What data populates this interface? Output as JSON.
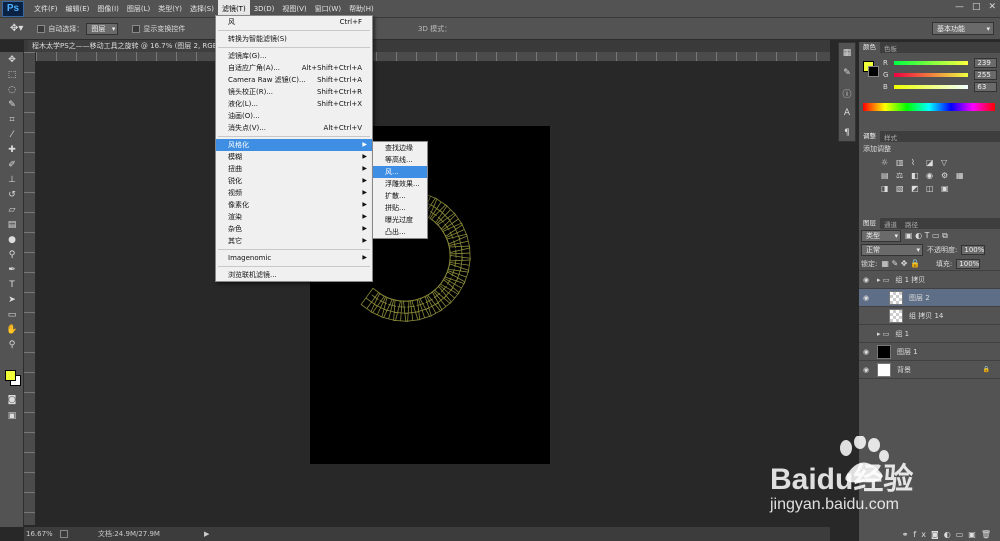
{
  "app": {
    "logo": "Ps"
  },
  "menubar": {
    "items": [
      "文件(F)",
      "编辑(E)",
      "图像(I)",
      "图层(L)",
      "类型(Y)",
      "选择(S)",
      "滤镜(T)",
      "3D(D)",
      "视图(V)",
      "窗口(W)",
      "帮助(H)"
    ],
    "active_index": 6,
    "window_controls": [
      "—",
      "□",
      "✕"
    ]
  },
  "options": {
    "auto_select_label": "自动选择：",
    "auto_select_value": "图层",
    "show_transform_label": "显示变换控件",
    "three_d_label": "3D 模式：",
    "workspace": "基本功能"
  },
  "document": {
    "tab_title": "程木太学PS之——移动工具之旋转 @ 16.7% (图层 2, RGB/8)"
  },
  "status": {
    "zoom": "16.67%",
    "doc_info": "文档:24.9M/27.9M"
  },
  "filter_menu": {
    "items": [
      {
        "label": "风",
        "shortcut": "Ctrl+F"
      },
      {
        "sep": true
      },
      {
        "label": "转换为智能滤镜(S)"
      },
      {
        "sep": true
      },
      {
        "label": "滤镜库(G)..."
      },
      {
        "label": "自适应广角(A)...",
        "shortcut": "Alt+Shift+Ctrl+A"
      },
      {
        "label": "Camera Raw 滤镜(C)...",
        "shortcut": "Shift+Ctrl+A"
      },
      {
        "label": "镜头校正(R)...",
        "shortcut": "Shift+Ctrl+R"
      },
      {
        "label": "液化(L)...",
        "shortcut": "Shift+Ctrl+X"
      },
      {
        "label": "油画(O)..."
      },
      {
        "label": "消失点(V)...",
        "shortcut": "Alt+Ctrl+V"
      },
      {
        "sep": true
      },
      {
        "label": "风格化",
        "sub": true,
        "highlight": true
      },
      {
        "label": "模糊",
        "sub": true
      },
      {
        "label": "扭曲",
        "sub": true
      },
      {
        "label": "锐化",
        "sub": true
      },
      {
        "label": "视频",
        "sub": true
      },
      {
        "label": "像素化",
        "sub": true
      },
      {
        "label": "渲染",
        "sub": true
      },
      {
        "label": "杂色",
        "sub": true
      },
      {
        "label": "其它",
        "sub": true
      },
      {
        "sep": true
      },
      {
        "label": "Imagenomic",
        "sub": true
      },
      {
        "sep": true
      },
      {
        "label": "浏览联机滤镜..."
      }
    ]
  },
  "stylize_submenu": {
    "items": [
      {
        "label": "查找边缘"
      },
      {
        "label": "等高线..."
      },
      {
        "label": "风...",
        "highlight": true
      },
      {
        "label": "浮雕效果..."
      },
      {
        "label": "扩散..."
      },
      {
        "label": "拼贴..."
      },
      {
        "label": "曝光过度"
      },
      {
        "label": "凸出..."
      }
    ]
  },
  "color_panel": {
    "tabs": [
      "颜色",
      "色板"
    ],
    "foreground": "#f1ff39",
    "channels": [
      {
        "label": "R",
        "value": "239"
      },
      {
        "label": "G",
        "value": "255"
      },
      {
        "label": "B",
        "value": "63"
      }
    ]
  },
  "adjust_panel": {
    "tabs": [
      "调整",
      "样式"
    ],
    "title": "添加调整"
  },
  "layers_panel": {
    "tabs": [
      "图层",
      "通道",
      "路径"
    ],
    "kind_label": "类型",
    "blend_mode": "正常",
    "opacity_label": "不透明度:",
    "opacity": "100%",
    "lock_label": "锁定:",
    "fill_label": "填充:",
    "fill": "100%",
    "layers": [
      {
        "name": "组 1 拷贝",
        "type": "group",
        "eye": true
      },
      {
        "name": "图层 2",
        "type": "layer",
        "eye": true,
        "selected": true,
        "thumb": "check"
      },
      {
        "name": "组 拷贝 14",
        "type": "layer",
        "eye": false,
        "thumb": "check"
      },
      {
        "name": "组 1",
        "type": "group",
        "eye": false
      },
      {
        "name": "图层 1",
        "type": "layer",
        "eye": true,
        "thumb": "black"
      },
      {
        "name": "背景",
        "type": "layer",
        "eye": true,
        "thumb": "white",
        "locked": true
      }
    ]
  },
  "watermark": {
    "brand": "Baidu经验",
    "url": "jingyan.baidu.com"
  }
}
